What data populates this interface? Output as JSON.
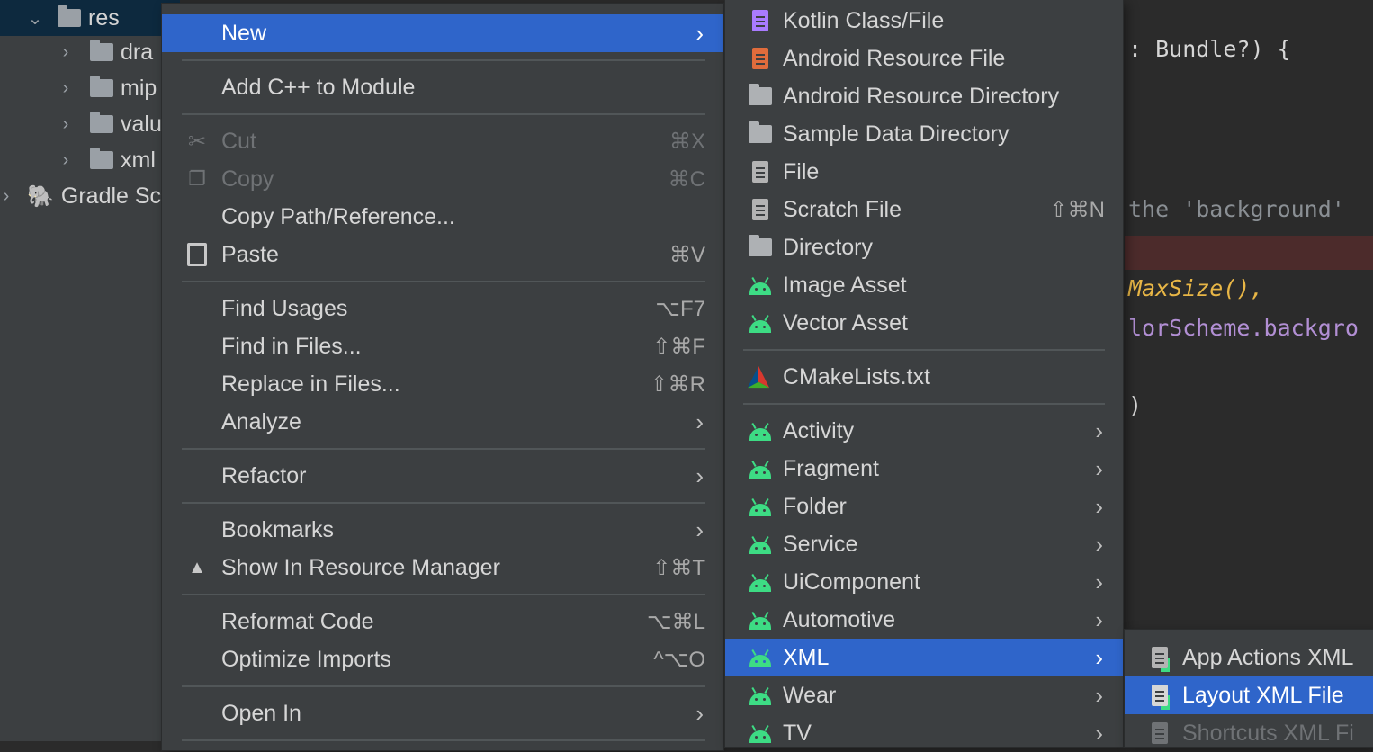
{
  "project_tree": {
    "items": [
      {
        "label": "res",
        "expanded": true
      },
      {
        "label": "dra"
      },
      {
        "label": "mip"
      },
      {
        "label": "valu"
      },
      {
        "label": "xml"
      },
      {
        "label": "Gradle Sc"
      }
    ]
  },
  "editor": {
    "lines": [
      ": Bundle?) {",
      "the 'background'",
      "MaxSize(),",
      "lorScheme.backgro",
      ")"
    ]
  },
  "context_menu": {
    "items": [
      {
        "label": "New",
        "arrow": "›"
      },
      {
        "label": "Add C++ to Module"
      },
      {
        "label": "Cut",
        "shortcut": "⌘X"
      },
      {
        "label": "Copy",
        "shortcut": "⌘C"
      },
      {
        "label": "Copy Path/Reference..."
      },
      {
        "label": "Paste",
        "shortcut": "⌘V"
      },
      {
        "label": "Find Usages",
        "shortcut": "⌥F7"
      },
      {
        "label": "Find in Files...",
        "shortcut": "⇧⌘F"
      },
      {
        "label": "Replace in Files...",
        "shortcut": "⇧⌘R"
      },
      {
        "label": "Analyze",
        "arrow": "›"
      },
      {
        "label": "Refactor",
        "arrow": "›"
      },
      {
        "label": "Bookmarks",
        "arrow": "›"
      },
      {
        "label": "Show In Resource Manager",
        "shortcut": "⇧⌘T"
      },
      {
        "label": "Reformat Code",
        "shortcut": "⌥⌘L"
      },
      {
        "label": "Optimize Imports",
        "shortcut": "^⌥O"
      },
      {
        "label": "Open In",
        "arrow": "›"
      }
    ]
  },
  "new_submenu": {
    "items": [
      {
        "label": "Kotlin Class/File"
      },
      {
        "label": "Android Resource File"
      },
      {
        "label": "Android Resource Directory"
      },
      {
        "label": "Sample Data Directory"
      },
      {
        "label": "File"
      },
      {
        "label": "Scratch File",
        "shortcut": "⇧⌘N"
      },
      {
        "label": "Directory"
      },
      {
        "label": "Image Asset"
      },
      {
        "label": "Vector Asset"
      },
      {
        "label": "CMakeLists.txt"
      },
      {
        "label": "Activity",
        "arrow": "›"
      },
      {
        "label": "Fragment",
        "arrow": "›"
      },
      {
        "label": "Folder",
        "arrow": "›"
      },
      {
        "label": "Service",
        "arrow": "›"
      },
      {
        "label": "UiComponent",
        "arrow": "›"
      },
      {
        "label": "Automotive",
        "arrow": "›"
      },
      {
        "label": "XML",
        "arrow": "›"
      },
      {
        "label": "Wear",
        "arrow": "›"
      },
      {
        "label": "TV",
        "arrow": "›"
      }
    ]
  },
  "xml_submenu": {
    "items": [
      {
        "label": "App Actions XML"
      },
      {
        "label": "Layout XML File"
      },
      {
        "label": "Shortcuts XML Fi"
      }
    ]
  },
  "colors": {
    "highlight": "#2f65ca",
    "menu_bg": "#3c3f41",
    "android_green": "#3ddc84"
  }
}
